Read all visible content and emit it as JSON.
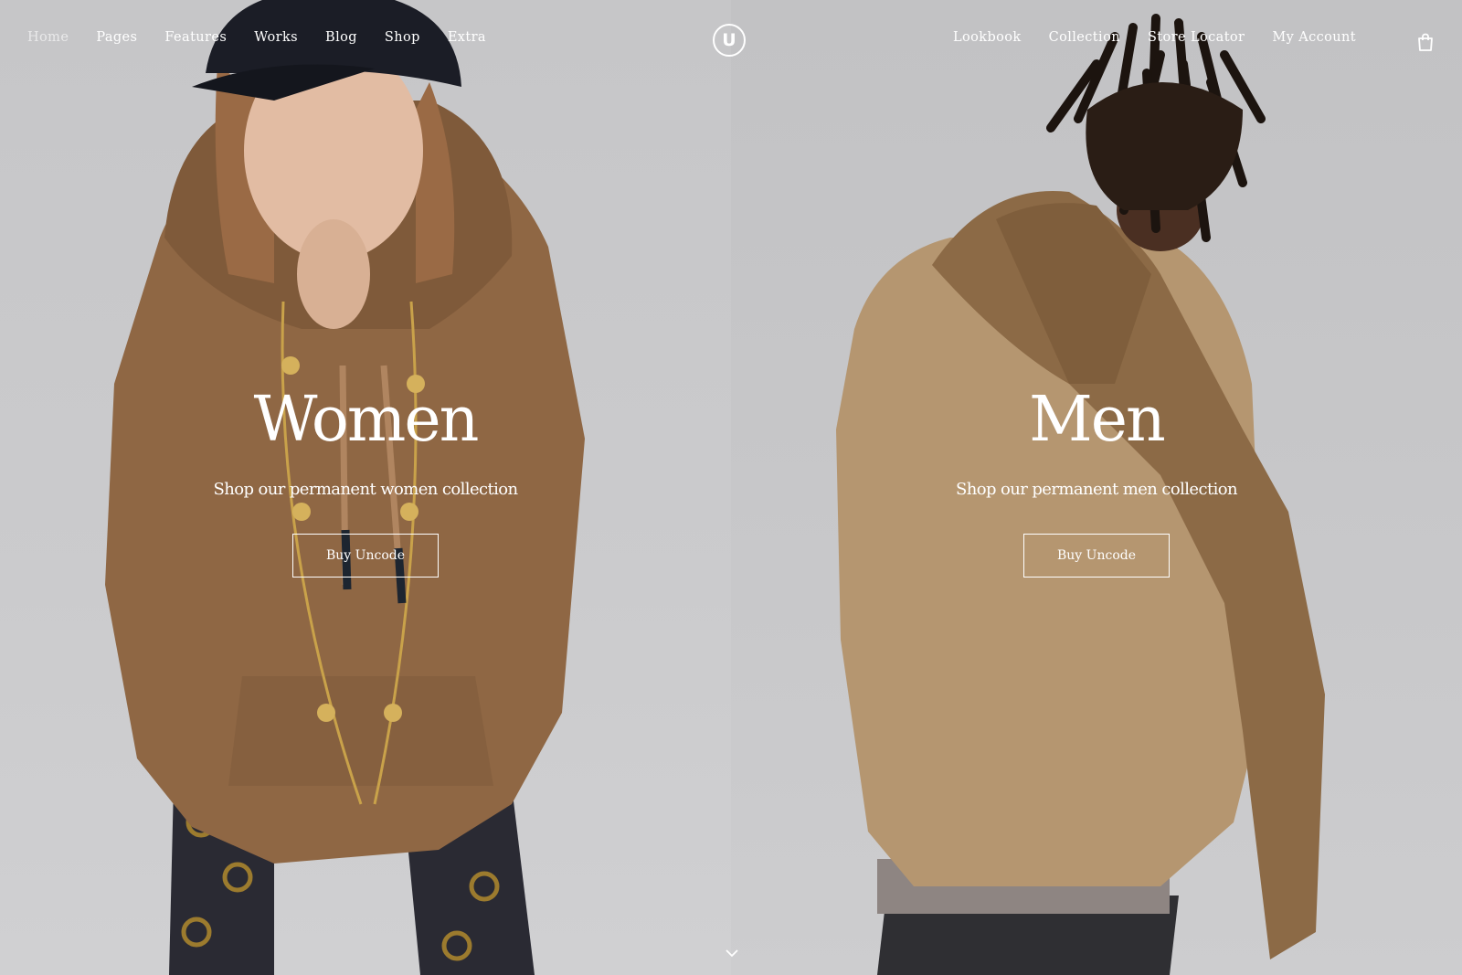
{
  "nav": {
    "left": [
      "Home",
      "Pages",
      "Features",
      "Works",
      "Blog",
      "Shop",
      "Extra"
    ],
    "right": [
      "Lookbook",
      "Collection",
      "Store Locator",
      "My Account"
    ],
    "logo_letter": "U"
  },
  "women": {
    "title": "Women",
    "subtitle": "Shop our permanent women collection",
    "button": "Buy Uncode"
  },
  "men": {
    "title": "Men",
    "subtitle": "Shop our permanent men collection",
    "button": "Buy Uncode"
  },
  "icons": {
    "cart": "shopping-bag-icon",
    "scroll": "chevron-down-icon"
  },
  "colors": {
    "background": "#c9c9cb",
    "hoodie_women": "#8f6744",
    "hoodie_men": "#b59670",
    "text": "#ffffff"
  }
}
